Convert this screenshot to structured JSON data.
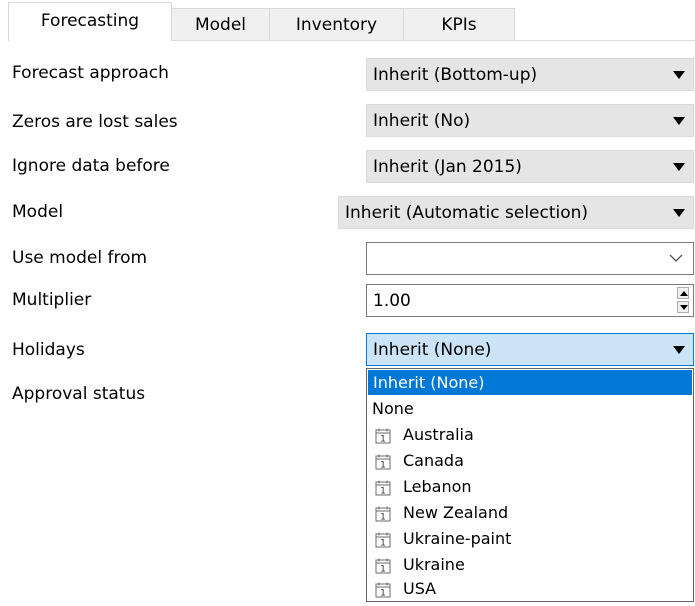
{
  "tabs": [
    "Forecasting",
    "Model",
    "Inventory",
    "KPIs"
  ],
  "rows": {
    "forecast_approach": {
      "label": "Forecast approach",
      "value": "Inherit (Bottom-up)"
    },
    "zeros_lost_sales": {
      "label": "Zeros are lost sales",
      "value": "Inherit (No)"
    },
    "ignore_data_before": {
      "label": "Ignore data before",
      "value": "Inherit (Jan 2015)"
    },
    "model": {
      "label": "Model",
      "value": "Inherit (Automatic selection)"
    },
    "use_model_from": {
      "label": "Use model from",
      "value": ""
    },
    "multiplier": {
      "label": "Multiplier",
      "value": "1.00"
    },
    "holidays": {
      "label": "Holidays",
      "value": "Inherit (None)"
    },
    "approval_status": {
      "label": "Approval status"
    }
  },
  "holidays_dropdown": {
    "options": [
      {
        "label": "Inherit (None)",
        "selected": true,
        "icon": null
      },
      {
        "label": "None",
        "selected": false,
        "icon": null
      },
      {
        "label": "Australia",
        "selected": false,
        "icon": "calendar-icon"
      },
      {
        "label": "Canada",
        "selected": false,
        "icon": "calendar-icon"
      },
      {
        "label": "Lebanon",
        "selected": false,
        "icon": "calendar-icon"
      },
      {
        "label": "New Zealand",
        "selected": false,
        "icon": "calendar-icon"
      },
      {
        "label": "Ukraine-paint",
        "selected": false,
        "icon": "calendar-icon"
      },
      {
        "label": "Ukraine",
        "selected": false,
        "icon": "calendar-icon"
      },
      {
        "label": "USA",
        "selected": false,
        "icon": "calendar-icon"
      }
    ],
    "calendar_icon_digit": "1"
  },
  "colors": {
    "selection": "#0078d7",
    "active_field": "#cce4f7"
  }
}
